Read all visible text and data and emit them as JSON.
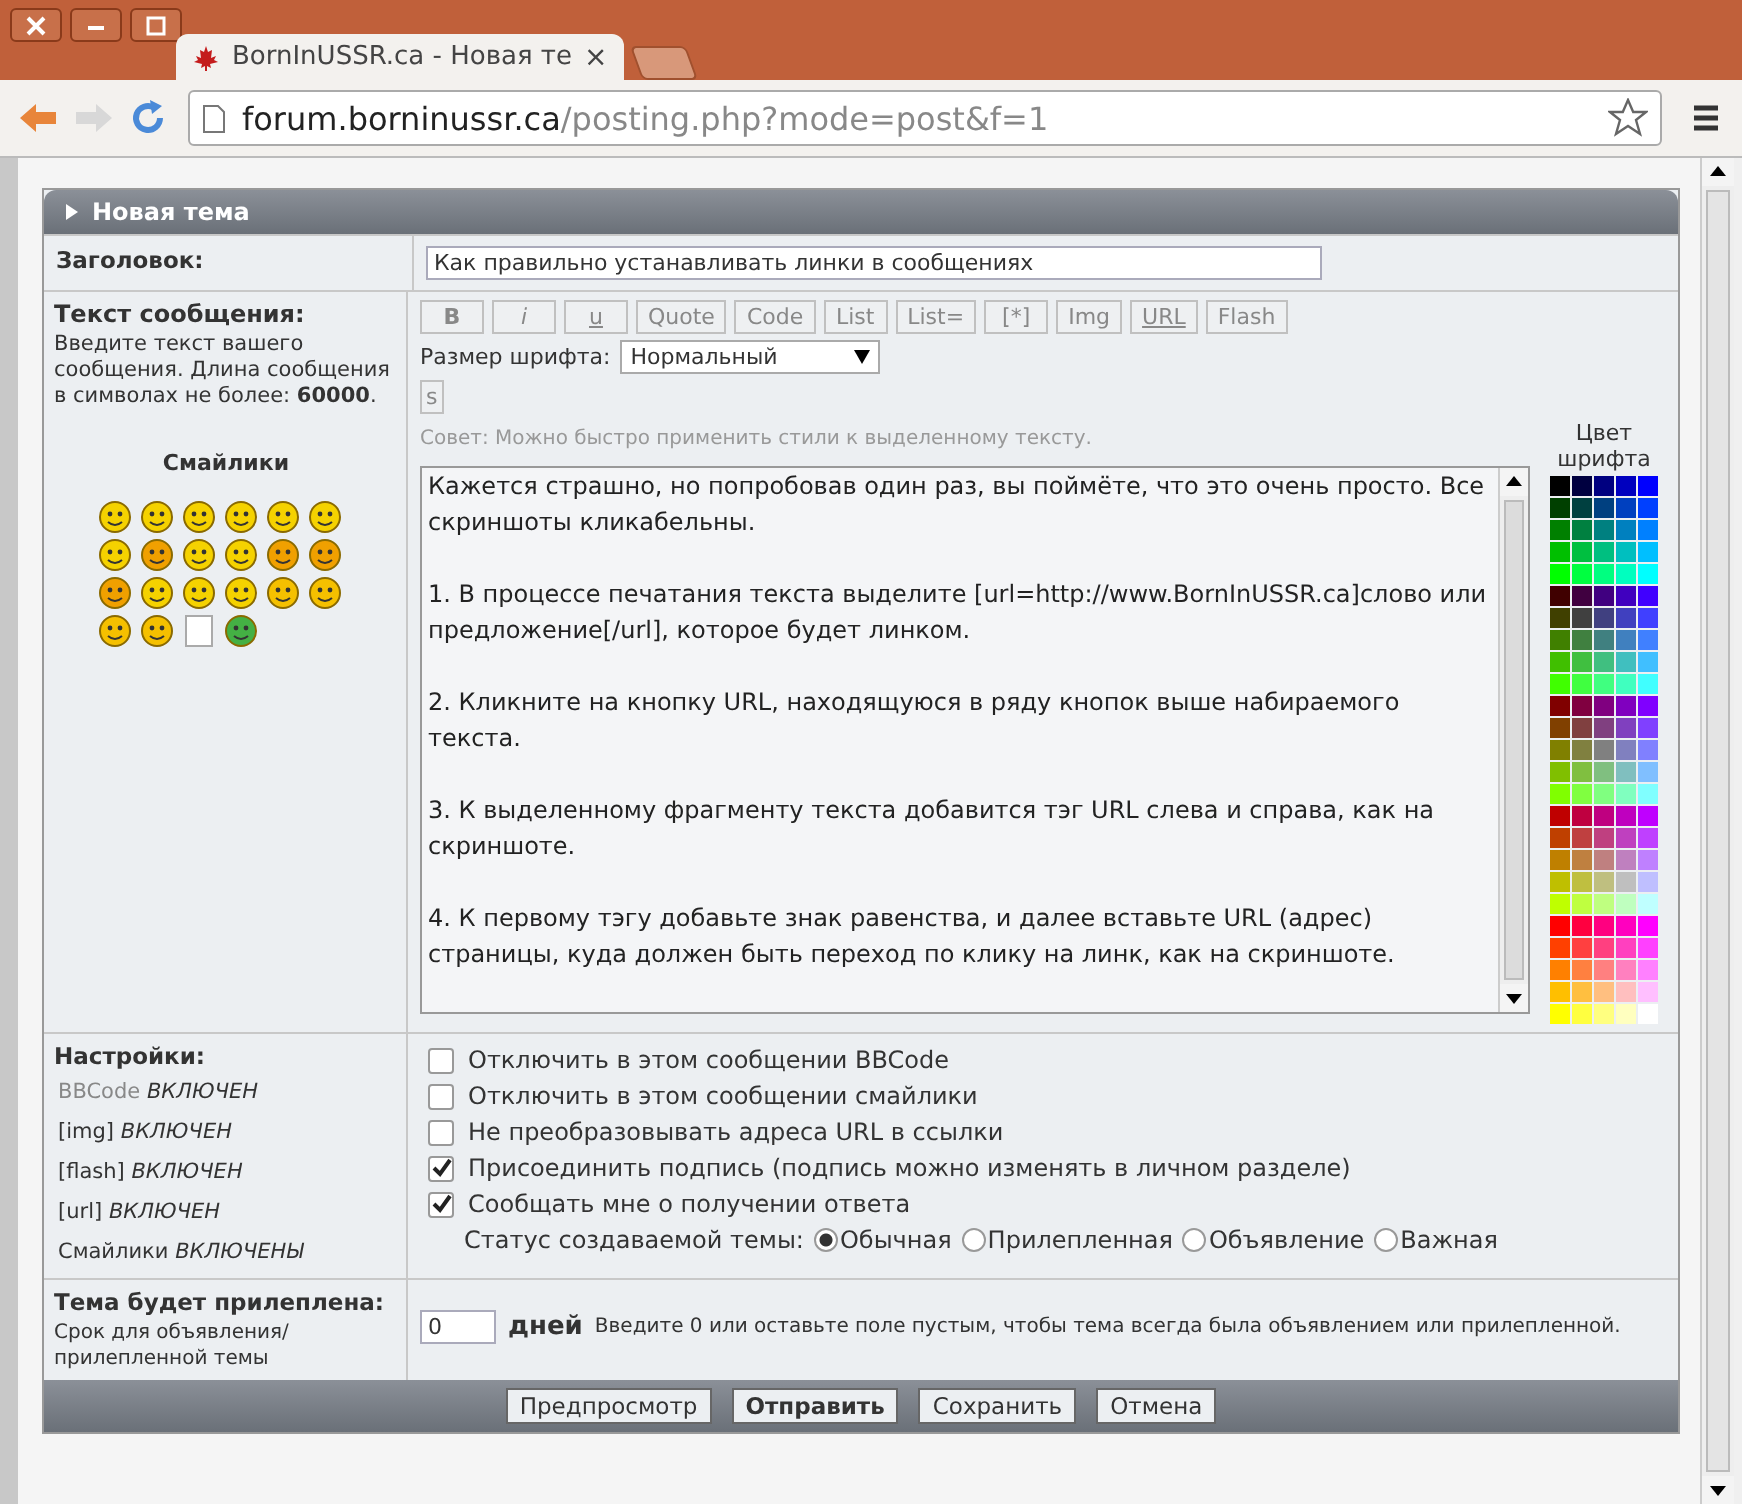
{
  "browser": {
    "tab_title": "BornInUSSR.ca - Новая те",
    "close_tab": "×",
    "url_host": "forum.borninussr.ca",
    "url_path": "/posting.php?mode=post&f=1"
  },
  "panel": {
    "title": "Новая тема",
    "subject": {
      "label": "Заголовок:",
      "value": "Как правильно устанавливать линки в сообщениях"
    },
    "message": {
      "label": "Текст сообщения:",
      "hint": "Введите текст вашего сообщения. Длина сообщения в символах не более: **60000**.",
      "smilies_title": "Смайлики",
      "toolbar": [
        {
          "label": "B",
          "kind": "bold"
        },
        {
          "label": "i",
          "kind": "italic"
        },
        {
          "label": "u",
          "kind": "underline"
        },
        {
          "label": "Quote",
          "kind": "plain"
        },
        {
          "label": "Code",
          "kind": "plain"
        },
        {
          "label": "List",
          "kind": "plain"
        },
        {
          "label": "List=",
          "kind": "plain"
        },
        {
          "label": "[*]",
          "kind": "plain"
        },
        {
          "label": "Img",
          "kind": "plain"
        },
        {
          "label": "URL",
          "kind": "underline"
        },
        {
          "label": "Flash",
          "kind": "plain"
        }
      ],
      "font_size_label": "Размер шрифта:",
      "font_size_value": "Нормальный",
      "strike_button": "s",
      "tip": "Совет: Можно быстро применить стили к выделенному тексту.",
      "text": "Кажется страшно, но попробовав один раз, вы поймёте, что это очень просто. Все скриншоты кликабельны.\n\n1. В процессе печатания текста выделите [url=http://www.BornInUSSR.ca]слово или предложение[/url], которое будет линком.\n\n2. Кликните на кнопку URL, находящуюся в ряду кнопок выше набираемого текста.\n\n3. К выделенному фрагменту текста добавится тэг URL слева и справа, как на скриншоте.\n\n4. К первому тэгу добавьте знак равенства, и далее вставьте URL (адрес) страницы, куда должен быть переход по клику на линк, как на скриншоте.",
      "palette_title": "Цвет шрифта"
    },
    "settings": {
      "label": "Настройки:",
      "status": [
        {
          "name": "BBCode",
          "value": "ВКЛЮЧЕН",
          "link": true
        },
        {
          "name": "[img]",
          "value": "ВКЛЮЧЕН",
          "link": false
        },
        {
          "name": "[flash]",
          "value": "ВКЛЮЧЕН",
          "link": false
        },
        {
          "name": "[url]",
          "value": "ВКЛЮЧЕН",
          "link": false
        },
        {
          "name": "Смайлики",
          "value": "ВКЛЮЧЕНЫ",
          "link": false
        }
      ],
      "options": [
        {
          "label": "Отключить в этом сообщении BBCode",
          "checked": false
        },
        {
          "label": "Отключить в этом сообщении смайлики",
          "checked": false
        },
        {
          "label": "Не преобразовывать адреса URL в ссылки",
          "checked": false
        },
        {
          "label": "Присоединить подпись (подпись можно изменять в личном разделе)",
          "checked": true
        },
        {
          "label": "Сообщать мне о получении ответа",
          "checked": true
        }
      ],
      "topic_type_label": "Статус создаваемой темы:",
      "topic_types": [
        {
          "label": "Обычная",
          "selected": true
        },
        {
          "label": "Прилепленная",
          "selected": false
        },
        {
          "label": "Объявление",
          "selected": false
        },
        {
          "label": "Важная",
          "selected": false
        }
      ]
    },
    "sticky": {
      "label": "Тема будет прилеплена:",
      "hint": "Срок для объявления/ прилепленной темы",
      "value": "0",
      "unit": "дней",
      "note": "Введите 0 или оставьте поле пустым, чтобы тема всегда была объявлением или прилепленной."
    },
    "buttons": [
      {
        "label": "Предпросмотр",
        "kind": "normal"
      },
      {
        "label": "Отправить",
        "kind": "primary"
      },
      {
        "label": "Сохранить",
        "kind": "normal"
      },
      {
        "label": "Отмена",
        "kind": "normal"
      }
    ]
  }
}
